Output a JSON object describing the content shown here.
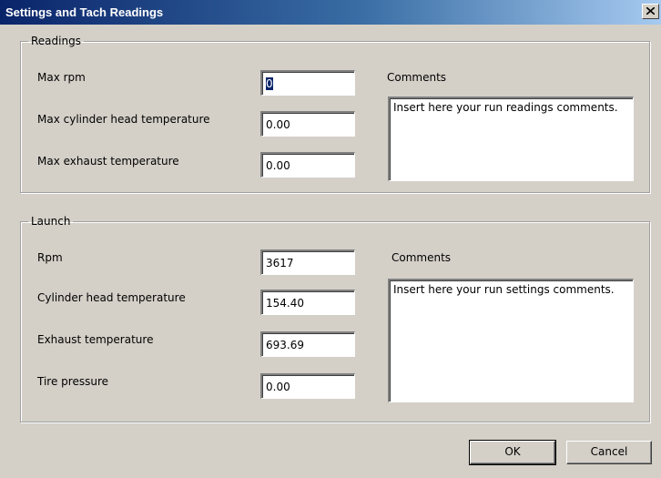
{
  "window": {
    "title": "Settings and Tach Readings"
  },
  "readings": {
    "legend": "Readings",
    "max_rpm_label": "Max rpm",
    "max_rpm_value": "0",
    "max_cyl_head_label": "Max cylinder head temperature",
    "max_cyl_head_value": "0.00",
    "max_exhaust_label": "Max exhaust temperature",
    "max_exhaust_value": "0.00",
    "comments_label": "Comments",
    "comments_value": "Insert here your run readings comments."
  },
  "launch": {
    "legend": "Launch",
    "rpm_label": "Rpm",
    "rpm_value": "3617",
    "cyl_head_label": "Cylinder head temperature",
    "cyl_head_value": "154.40",
    "exhaust_label": "Exhaust temperature",
    "exhaust_value": "693.69",
    "tire_label": "Tire pressure",
    "tire_value": "0.00",
    "comments_label": "Comments",
    "comments_value": "Insert here your run settings comments."
  },
  "buttons": {
    "ok": "OK",
    "cancel": "Cancel"
  }
}
